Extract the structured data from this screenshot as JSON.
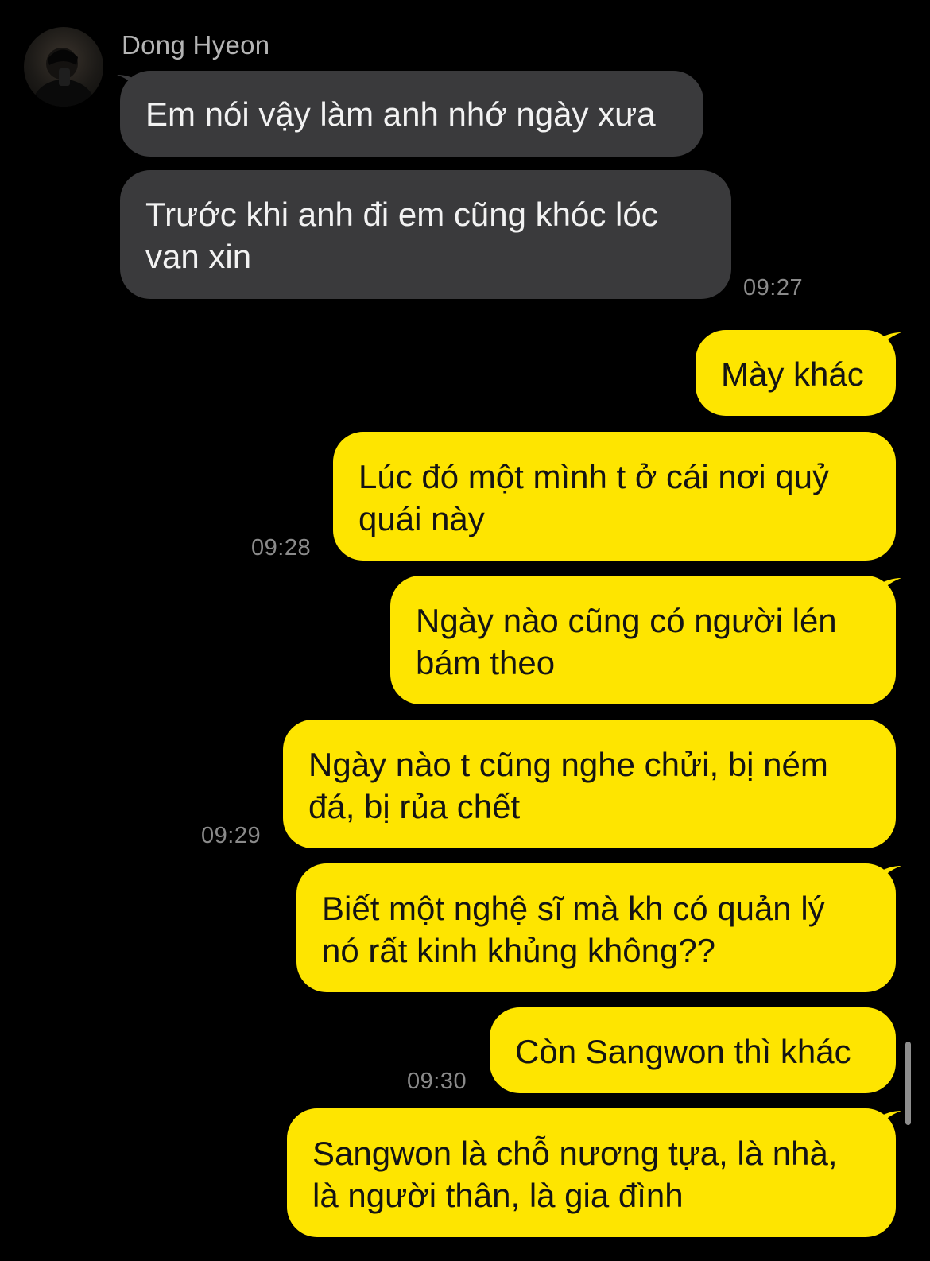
{
  "chat": {
    "sender_name": "Dong Hyeon",
    "messages": [
      {
        "text": "Em nói vậy làm anh nhớ ngày xưa"
      },
      {
        "text": "Trước khi anh đi em cũng khóc lóc van xin",
        "time": "09:27"
      },
      {
        "text": "Mày khác"
      },
      {
        "text": "Lúc đó một mình t ở cái nơi quỷ quái này",
        "time": "09:28"
      },
      {
        "text": "Ngày nào cũng có người lén bám theo"
      },
      {
        "text": "Ngày nào t cũng nghe chửi, bị ném đá, bị rủa chết",
        "time": "09:29"
      },
      {
        "text": "Biết một nghệ sĩ mà kh có quản lý nó rất kinh khủng không??"
      },
      {
        "text": "Còn Sangwon thì khác",
        "time": "09:30"
      },
      {
        "text": "Sangwon là chỗ nương tựa, là nhà, là người thân, là gia đình"
      }
    ]
  },
  "colors": {
    "background": "#000000",
    "incoming_bubble": "#3a3a3c",
    "outgoing_bubble": "#fee500",
    "timestamp": "#8a8a8a"
  },
  "icons": {
    "avatar": "profile-photo"
  }
}
